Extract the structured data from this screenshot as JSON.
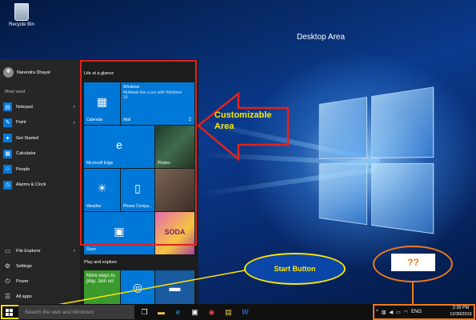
{
  "desktop": {
    "recycle_bin_label": "Recycle Bin",
    "area_label": "Desktop Area"
  },
  "start_menu": {
    "user_name": "Narendra Dhayal",
    "most_used_label": "Most used",
    "apps": [
      {
        "label": "Notepad",
        "icon": "notepad-icon",
        "glyph": "▤",
        "has_arrow": true
      },
      {
        "label": "Paint",
        "icon": "paint-icon",
        "glyph": "✎",
        "has_arrow": true
      },
      {
        "label": "Get Started",
        "icon": "lightbulb-icon",
        "glyph": "✦",
        "has_arrow": false
      },
      {
        "label": "Calculator",
        "icon": "calculator-icon",
        "glyph": "▦",
        "has_arrow": false
      },
      {
        "label": "People",
        "icon": "people-icon",
        "glyph": "☺",
        "has_arrow": false
      },
      {
        "label": "Alarms & Clock",
        "icon": "clock-icon",
        "glyph": "◷",
        "has_arrow": false
      }
    ],
    "bottom": [
      {
        "label": "File Explorer",
        "icon": "folder-icon",
        "glyph": "▭",
        "has_arrow": true
      },
      {
        "label": "Settings",
        "icon": "gear-icon",
        "glyph": "⚙",
        "has_arrow": false
      },
      {
        "label": "Power",
        "icon": "power-icon",
        "glyph": "⏻",
        "has_arrow": false
      },
      {
        "label": "All apps",
        "icon": "list-icon",
        "glyph": "☰",
        "has_arrow": false
      }
    ],
    "tiles": {
      "group1_label": "Life at a glance",
      "group2_label": "Play and explore",
      "calendar": "Calendar",
      "mail": "Mail",
      "mail_count": "2",
      "mail_preview_title": "Windows",
      "mail_preview_body": "Multitask like a pro with Windows 10",
      "edge": "Microsoft Edge",
      "photos": "Photos",
      "weather": "Weather",
      "phone": "Phone Compa...",
      "store": "Store",
      "candy": "SODA",
      "xbox_text": "More ways to play. Join us!"
    }
  },
  "annotations": {
    "customizable": "Customizable Area",
    "start_button": "Start Button",
    "unknown": "??"
  },
  "taskbar": {
    "search_placeholder": "Search the web and Windows",
    "language": "ENG",
    "time": "2:39 PM",
    "date": "12/30/2015"
  },
  "colors": {
    "accent": "#0078d7",
    "annotation_red": "#e0231b",
    "annotation_yellow": "#ffe600",
    "annotation_orange": "#f07a1d"
  }
}
